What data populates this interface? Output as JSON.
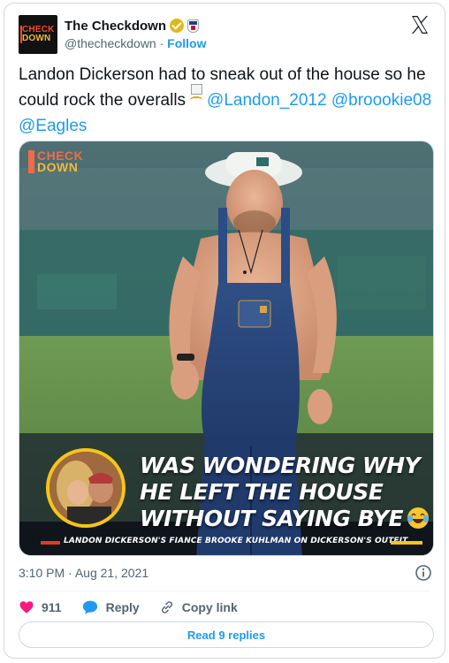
{
  "author": {
    "display_name": "The Checkdown",
    "handle": "@thecheckdown",
    "separator": "·",
    "follow_label": "Follow",
    "avatar_text_line1": "CHECK",
    "avatar_text_line2": "DOWN"
  },
  "tweet": {
    "text_before": "Landon Dickerson had to sneak out of the house so he could rock the overalls",
    "mentions": [
      "@Landon_2012",
      "@broookie08",
      "@Eagles"
    ]
  },
  "media": {
    "watermark_line1": "CHECK",
    "watermark_line2": "DOWN",
    "caption_lines": [
      "WAS WONDERING WHY",
      "HE LEFT THE HOUSE",
      "WITHOUT SAYING BYE"
    ],
    "subline": "LANDON DICKERSON'S FIANCE BROOKE KUHLMAN ON DICKERSON'S OUTFIT"
  },
  "meta": {
    "time": "3:10 PM",
    "date_sep": "·",
    "date": "Aug 21, 2021"
  },
  "actions": {
    "like_count": "911",
    "reply_label": "Reply",
    "copy_link_label": "Copy link"
  },
  "footer": {
    "read_replies_label": "Read 9 replies"
  },
  "colors": {
    "accent": "#1d9bf0",
    "like": "#f91880",
    "verified": "#e2b719",
    "text": "#0f1419",
    "secondary": "#536471"
  }
}
